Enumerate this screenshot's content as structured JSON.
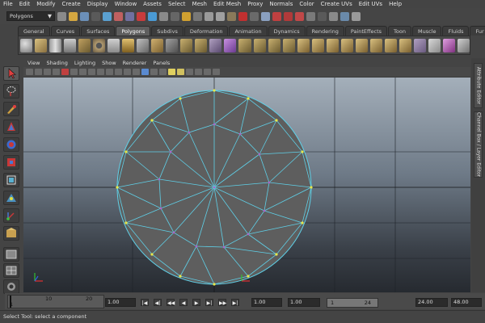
{
  "menubar": [
    "File",
    "Edit",
    "Modify",
    "Create",
    "Display",
    "Window",
    "Assets",
    "Select",
    "Mesh",
    "Edit Mesh",
    "Proxy",
    "Normals",
    "Color",
    "Create UVs",
    "Edit UVs",
    "Help"
  ],
  "status_line": {
    "mode": "Polygons",
    "dropdown_arrow": "▼"
  },
  "shelf": {
    "tabs": [
      "General",
      "Curves",
      "Surfaces",
      "Polygons",
      "Subdivs",
      "Deformation",
      "Animation",
      "Dynamics",
      "Rendering",
      "PaintEffects",
      "Toon",
      "Muscle",
      "Fluids",
      "Fur"
    ],
    "active_tab": "Polygons"
  },
  "panel": {
    "menu": [
      "View",
      "Shading",
      "Lighting",
      "Show",
      "Renderer",
      "Panels"
    ]
  },
  "side_tabs": [
    "Attribute Editor",
    "Channel Box / Layer Editor"
  ],
  "timeslider": {
    "ticks": [
      "1",
      "10",
      "20"
    ],
    "current_time": "1.00",
    "start_time": "1.00",
    "playback_start": "1.00",
    "range_start": "1",
    "range_end": "24",
    "playback_end": "24.00",
    "end_time": "48.00"
  },
  "playback": [
    "|◀",
    "◀|",
    "◀◀",
    "◀",
    "▶",
    "▶|",
    "▶▶",
    "▶|"
  ],
  "help_line": "Select Tool: select a component",
  "colors": {
    "wire": "#5fd0e8",
    "vertex": "#e8e84a",
    "vertex_inner": "#b060c8",
    "mesh_face": "#5e5e5e",
    "axis_x": "#e03030",
    "axis_y": "#30c030",
    "axis_z": "#3060e0"
  }
}
